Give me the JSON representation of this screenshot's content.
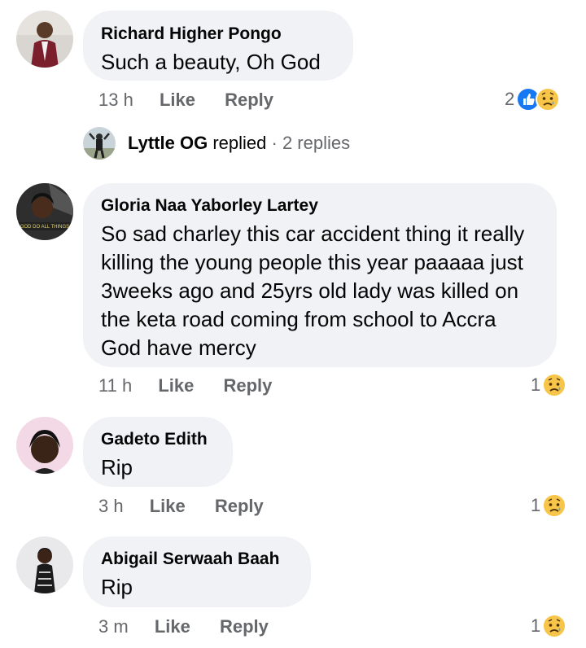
{
  "comments": [
    {
      "author": "Richard Higher Pongo",
      "text": "Such a beauty, Oh God",
      "time": "13 h",
      "like": "Like",
      "reply": "Reply",
      "reaction_count": "2",
      "reactions": [
        "like-icon",
        "sad-icon"
      ]
    },
    {
      "author": "Gloria Naa Yaborley Lartey",
      "text": "So sad charley this car accident thing it really killing the young people this year paaaaa just 3weeks ago and 25yrs old lady was killed on the keta road coming from school to Accra  God have mercy",
      "time": "11 h",
      "like": "Like",
      "reply": "Reply",
      "reaction_count": "1",
      "reactions": [
        "sad-icon"
      ]
    },
    {
      "author": "Gadeto Edith",
      "text": "Rip",
      "time": "3 h",
      "like": "Like",
      "reply": "Reply",
      "reaction_count": "1",
      "reactions": [
        "sad-icon"
      ]
    },
    {
      "author": "Abigail Serwaah Baah",
      "text": "Rip",
      "time": "3 m",
      "like": "Like",
      "reply": "Reply",
      "reaction_count": "1",
      "reactions": [
        "sad-icon"
      ]
    }
  ],
  "replies_summary": {
    "author": "Lyttle OG",
    "action": "replied",
    "separator": "·",
    "count": "2 replies"
  },
  "colors": {
    "bubble": "#f0f2f5",
    "muted": "#65676b",
    "like_blue": "#1877f2",
    "sad_yellow": "#f7c54a"
  }
}
